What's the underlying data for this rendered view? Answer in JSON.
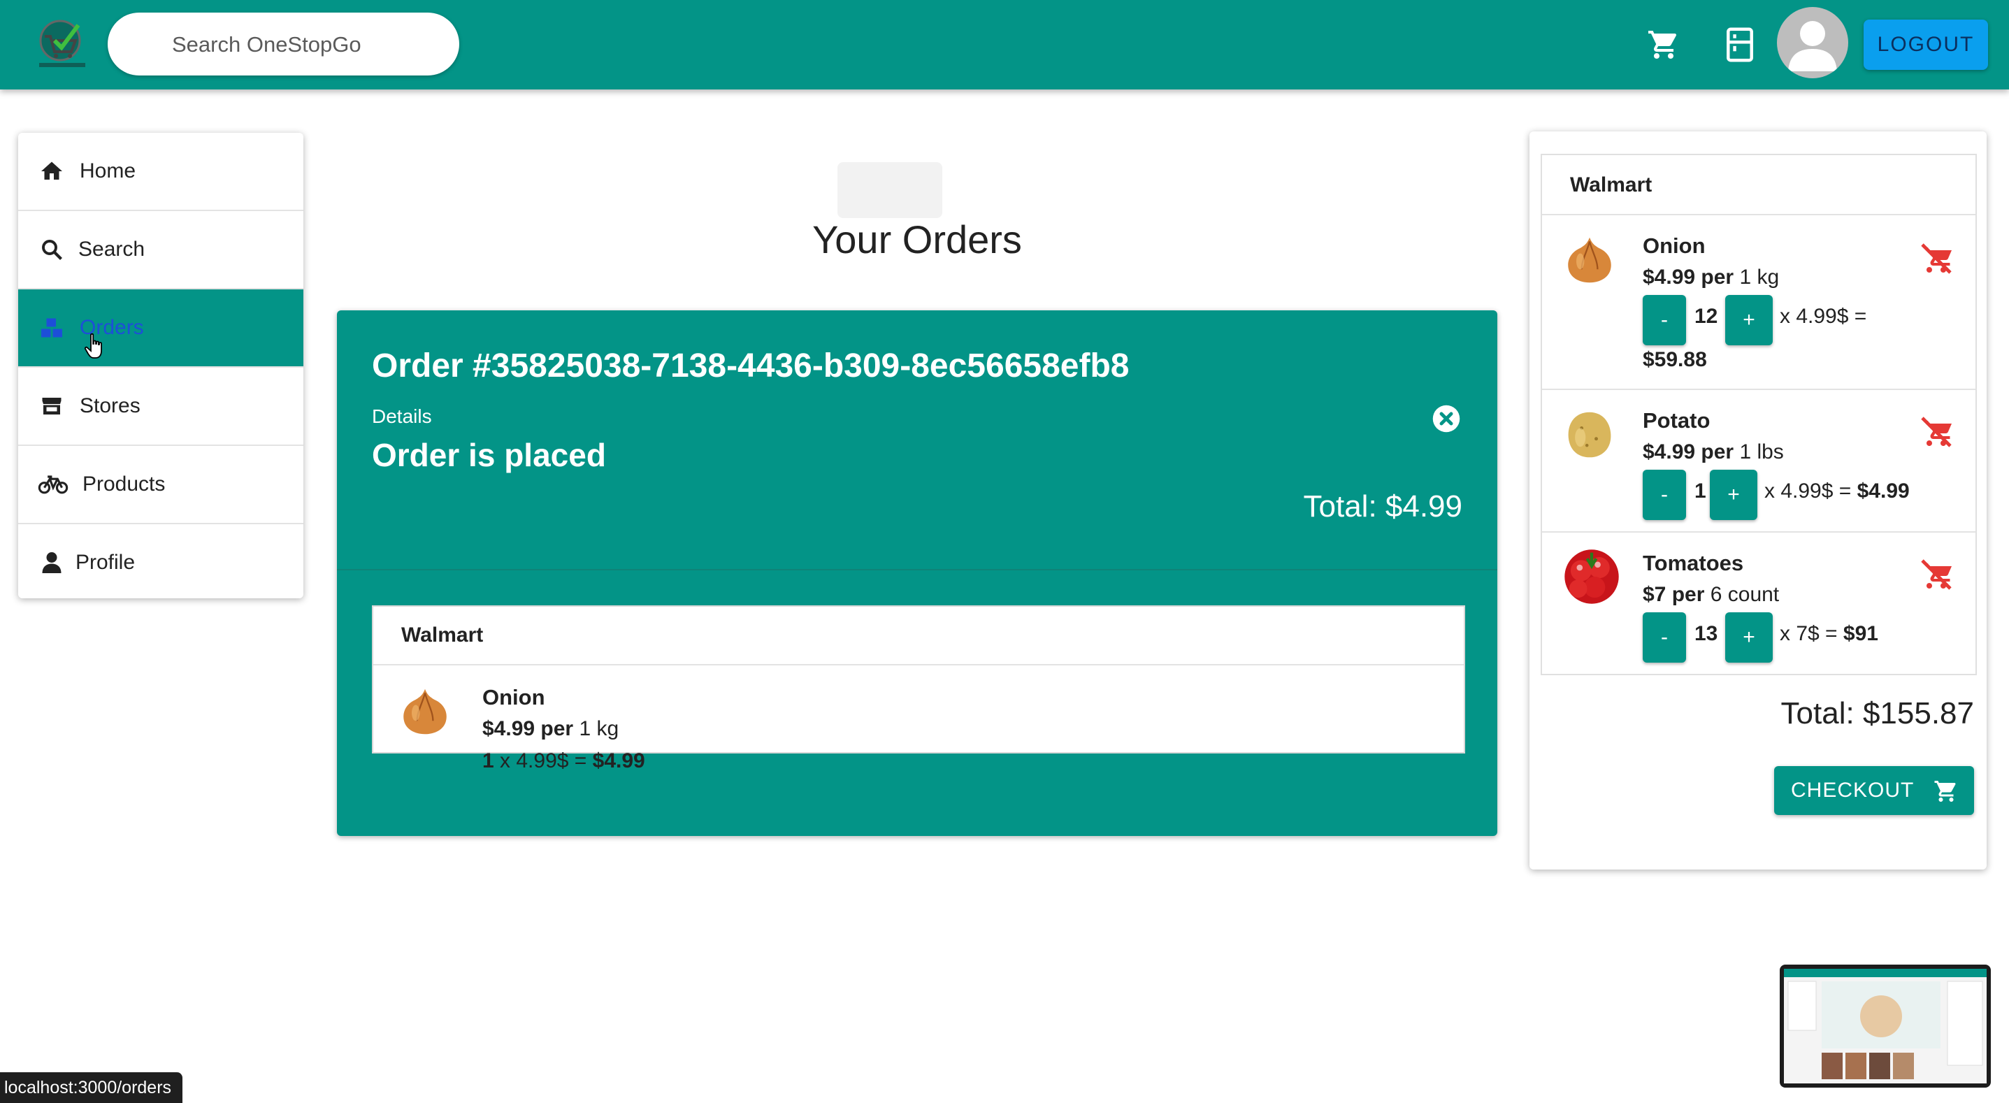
{
  "header": {
    "search_placeholder": "Search OneStopGo",
    "logout_label": "LOGOUT"
  },
  "sidebar": {
    "items": [
      {
        "label": "Home"
      },
      {
        "label": "Search"
      },
      {
        "label": "Orders"
      },
      {
        "label": "Stores"
      },
      {
        "label": "Products"
      },
      {
        "label": "Profile"
      }
    ],
    "active": "Orders"
  },
  "main": {
    "title": "Your Orders",
    "order": {
      "id": "Order #35825038-7138-4436-b309-8ec56658efb8",
      "details_label": "Details",
      "status": "Order is placed",
      "total": "Total: $4.99",
      "store": "Walmart",
      "items": [
        {
          "name": "Onion",
          "price": "$4.99 per",
          "unit": "1 kg",
          "qty": "1",
          "calc": "x 4.99$ =",
          "subtotal": "$4.99"
        }
      ]
    }
  },
  "cart": {
    "store": "Walmart",
    "items": [
      {
        "name": "Onion",
        "price": "$4.99 per",
        "unit": "1 kg",
        "qty": "12",
        "calc": "x 4.99$ =",
        "subtotal": "$59.88",
        "image": "onion"
      },
      {
        "name": "Potato",
        "price": "$4.99 per",
        "unit": "1 lbs",
        "qty": "1",
        "calc": "x 4.99$ =",
        "subtotal": "$4.99",
        "image": "potato"
      },
      {
        "name": "Tomatoes",
        "price": "$7 per",
        "unit": "6 count",
        "qty": "13",
        "calc": "x 7$ =",
        "subtotal": "$91",
        "image": "tomato"
      }
    ],
    "minus_label": "-",
    "plus_label": "+",
    "total": "Total: $155.87",
    "checkout_label": "CHECKOUT"
  },
  "status_bar": {
    "url": "localhost:3000/orders"
  },
  "colors": {
    "primary": "#039487",
    "logout": "#0a9fee",
    "remove": "#e53935"
  }
}
